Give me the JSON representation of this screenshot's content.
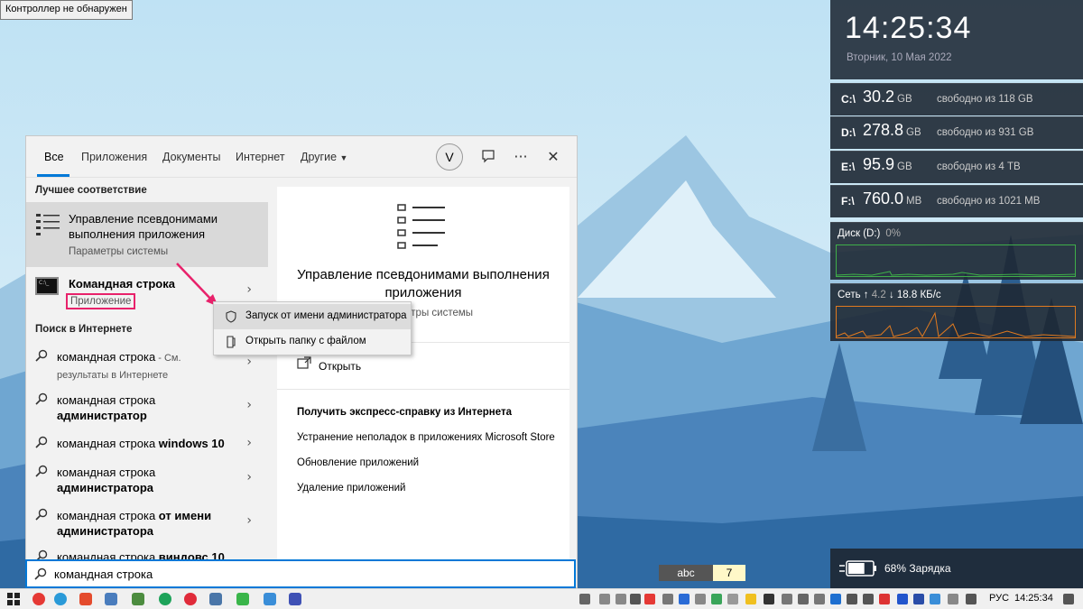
{
  "tooltip": "Контроллер не обнаружен",
  "tabs": [
    {
      "label": "Все"
    },
    {
      "label": "Приложения"
    },
    {
      "label": "Документы"
    },
    {
      "label": "Интернет"
    },
    {
      "label": "Другие"
    }
  ],
  "avatar_letter": "V",
  "best_match": {
    "section": "Лучшее соответствие",
    "title": "Управление псевдонимами выполнения приложения",
    "subtitle": "Параметры системы"
  },
  "app_result": {
    "title": "Командная строка",
    "subtitle": "Приложение"
  },
  "web_section": "Поиск в Интернете",
  "web_results": [
    {
      "normal": "командная строка",
      "bold": "",
      "suffix": " - См.",
      "gray": "результаты в Интернете"
    },
    {
      "normal": "командная строка ",
      "bold": "администратор",
      "suffix": "",
      "gray": ""
    },
    {
      "normal": "командная строка ",
      "bold": "windows 10",
      "suffix": "",
      "gray": ""
    },
    {
      "normal": "командная строка ",
      "bold": "администратора",
      "suffix": "",
      "gray": ""
    },
    {
      "normal": "командная строка ",
      "bold": "от имени администратора",
      "suffix": "",
      "gray": ""
    },
    {
      "normal": "командная строка ",
      "bold": "виндовс 10",
      "suffix": "",
      "gray": ""
    }
  ],
  "preview": {
    "title": "Управление псевдонимами выполнения приложения",
    "subtitle": "Параметры системы",
    "open": "Открыть",
    "help_heading": "Получить экспресс-справку из Интернета",
    "links": [
      "Устранение неполадок в приложениях Microsoft Store",
      "Обновление приложений",
      "Удаление приложений"
    ]
  },
  "context_menu": [
    {
      "label": "Запуск от имени администратора",
      "icon": "shield-icon"
    },
    {
      "label": "Открыть папку с файлом",
      "icon": "folder-icon"
    }
  ],
  "search": {
    "value": "командная строка"
  },
  "clock": {
    "time": "14:25:34",
    "date": "Вторник, 10 Мая 2022"
  },
  "drives": [
    {
      "letter": "C:\\",
      "value": "30.2",
      "unit": "GB",
      "free": "свободно из 118 GB"
    },
    {
      "letter": "D:\\",
      "value": "278.8",
      "unit": "GB",
      "free": "свободно из 931 GB"
    },
    {
      "letter": "E:\\",
      "value": "95.9",
      "unit": "GB",
      "free": "свободно из 4 TB"
    },
    {
      "letter": "F:\\",
      "value": "760.0",
      "unit": "MB",
      "free": "свободно из 1021 MB"
    }
  ],
  "disk_widget": {
    "label": "Диск (D:)",
    "value": "0%",
    "color": "#3fae49"
  },
  "net_widget": {
    "label": "Сеть",
    "up": "4.2",
    "down": "18.8 КБ/с",
    "color": "#e07a1f"
  },
  "battery": {
    "percent": "68%",
    "status": "Зарядка",
    "level": 0.68
  },
  "lang_indicator": {
    "text": "abc",
    "num": "7"
  },
  "taskbar": {
    "lang": "РУС",
    "time": "14:25:34"
  },
  "colors": {
    "accent": "#0078d7",
    "highlight": "#e8226b"
  }
}
